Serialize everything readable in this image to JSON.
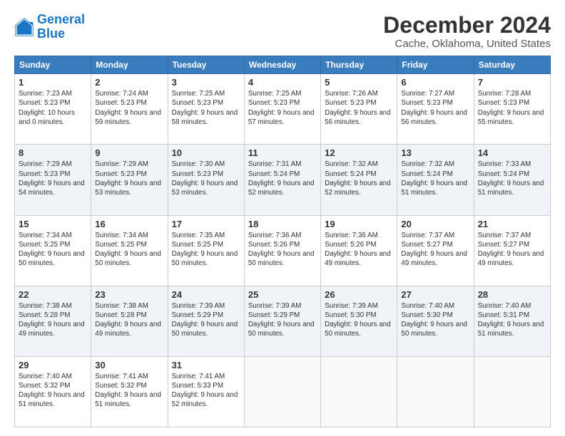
{
  "logo": {
    "line1": "General",
    "line2": "Blue"
  },
  "title": "December 2024",
  "subtitle": "Cache, Oklahoma, United States",
  "weekdays": [
    "Sunday",
    "Monday",
    "Tuesday",
    "Wednesday",
    "Thursday",
    "Friday",
    "Saturday"
  ],
  "weeks": [
    [
      {
        "day": 1,
        "sunrise": "7:23 AM",
        "sunset": "5:23 PM",
        "daylight": "10 hours and 0 minutes."
      },
      {
        "day": 2,
        "sunrise": "7:24 AM",
        "sunset": "5:23 PM",
        "daylight": "9 hours and 59 minutes."
      },
      {
        "day": 3,
        "sunrise": "7:25 AM",
        "sunset": "5:23 PM",
        "daylight": "9 hours and 58 minutes."
      },
      {
        "day": 4,
        "sunrise": "7:25 AM",
        "sunset": "5:23 PM",
        "daylight": "9 hours and 57 minutes."
      },
      {
        "day": 5,
        "sunrise": "7:26 AM",
        "sunset": "5:23 PM",
        "daylight": "9 hours and 56 minutes."
      },
      {
        "day": 6,
        "sunrise": "7:27 AM",
        "sunset": "5:23 PM",
        "daylight": "9 hours and 56 minutes."
      },
      {
        "day": 7,
        "sunrise": "7:28 AM",
        "sunset": "5:23 PM",
        "daylight": "9 hours and 55 minutes."
      }
    ],
    [
      {
        "day": 8,
        "sunrise": "7:29 AM",
        "sunset": "5:23 PM",
        "daylight": "9 hours and 54 minutes."
      },
      {
        "day": 9,
        "sunrise": "7:29 AM",
        "sunset": "5:23 PM",
        "daylight": "9 hours and 53 minutes."
      },
      {
        "day": 10,
        "sunrise": "7:30 AM",
        "sunset": "5:23 PM",
        "daylight": "9 hours and 53 minutes."
      },
      {
        "day": 11,
        "sunrise": "7:31 AM",
        "sunset": "5:24 PM",
        "daylight": "9 hours and 52 minutes."
      },
      {
        "day": 12,
        "sunrise": "7:32 AM",
        "sunset": "5:24 PM",
        "daylight": "9 hours and 52 minutes."
      },
      {
        "day": 13,
        "sunrise": "7:32 AM",
        "sunset": "5:24 PM",
        "daylight": "9 hours and 51 minutes."
      },
      {
        "day": 14,
        "sunrise": "7:33 AM",
        "sunset": "5:24 PM",
        "daylight": "9 hours and 51 minutes."
      }
    ],
    [
      {
        "day": 15,
        "sunrise": "7:34 AM",
        "sunset": "5:25 PM",
        "daylight": "9 hours and 50 minutes."
      },
      {
        "day": 16,
        "sunrise": "7:34 AM",
        "sunset": "5:25 PM",
        "daylight": "9 hours and 50 minutes."
      },
      {
        "day": 17,
        "sunrise": "7:35 AM",
        "sunset": "5:25 PM",
        "daylight": "9 hours and 50 minutes."
      },
      {
        "day": 18,
        "sunrise": "7:36 AM",
        "sunset": "5:26 PM",
        "daylight": "9 hours and 50 minutes."
      },
      {
        "day": 19,
        "sunrise": "7:36 AM",
        "sunset": "5:26 PM",
        "daylight": "9 hours and 49 minutes."
      },
      {
        "day": 20,
        "sunrise": "7:37 AM",
        "sunset": "5:27 PM",
        "daylight": "9 hours and 49 minutes."
      },
      {
        "day": 21,
        "sunrise": "7:37 AM",
        "sunset": "5:27 PM",
        "daylight": "9 hours and 49 minutes."
      }
    ],
    [
      {
        "day": 22,
        "sunrise": "7:38 AM",
        "sunset": "5:28 PM",
        "daylight": "9 hours and 49 minutes."
      },
      {
        "day": 23,
        "sunrise": "7:38 AM",
        "sunset": "5:28 PM",
        "daylight": "9 hours and 49 minutes."
      },
      {
        "day": 24,
        "sunrise": "7:39 AM",
        "sunset": "5:29 PM",
        "daylight": "9 hours and 50 minutes."
      },
      {
        "day": 25,
        "sunrise": "7:39 AM",
        "sunset": "5:29 PM",
        "daylight": "9 hours and 50 minutes."
      },
      {
        "day": 26,
        "sunrise": "7:39 AM",
        "sunset": "5:30 PM",
        "daylight": "9 hours and 50 minutes."
      },
      {
        "day": 27,
        "sunrise": "7:40 AM",
        "sunset": "5:30 PM",
        "daylight": "9 hours and 50 minutes."
      },
      {
        "day": 28,
        "sunrise": "7:40 AM",
        "sunset": "5:31 PM",
        "daylight": "9 hours and 51 minutes."
      }
    ],
    [
      {
        "day": 29,
        "sunrise": "7:40 AM",
        "sunset": "5:32 PM",
        "daylight": "9 hours and 51 minutes."
      },
      {
        "day": 30,
        "sunrise": "7:41 AM",
        "sunset": "5:32 PM",
        "daylight": "9 hours and 51 minutes."
      },
      {
        "day": 31,
        "sunrise": "7:41 AM",
        "sunset": "5:33 PM",
        "daylight": "9 hours and 52 minutes."
      },
      null,
      null,
      null,
      null
    ]
  ]
}
